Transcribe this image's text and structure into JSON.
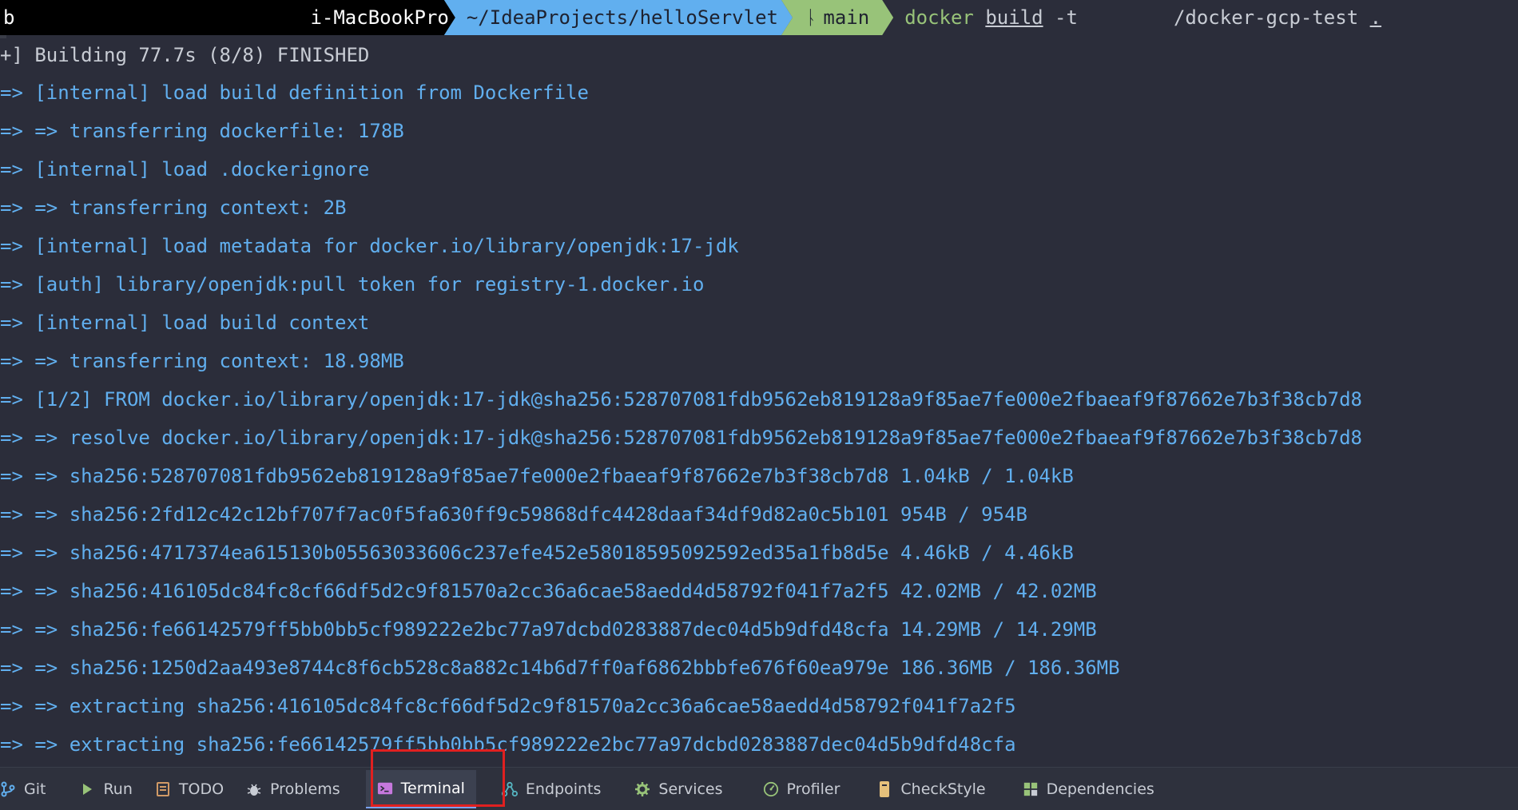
{
  "prompt": {
    "user_host": "i-MacBookPro",
    "leading_char": "b",
    "path": "~/IdeaProjects/helloServlet",
    "branch_icon": "git-branch-icon",
    "branch": "main",
    "command": "docker",
    "args": [
      "build",
      "-t",
      "/docker-gcp-test",
      "."
    ]
  },
  "output_lines": [
    "+] Building 77.7s (8/8) FINISHED",
    "=> [internal] load build definition from Dockerfile",
    "=> => transferring dockerfile: 178B",
    "=> [internal] load .dockerignore",
    "=> => transferring context: 2B",
    "=> [internal] load metadata for docker.io/library/openjdk:17-jdk",
    "=> [auth] library/openjdk:pull token for registry-1.docker.io",
    "=> [internal] load build context",
    "=> => transferring context: 18.98MB",
    "=> [1/2] FROM docker.io/library/openjdk:17-jdk@sha256:528707081fdb9562eb819128a9f85ae7fe000e2fbaeaf9f87662e7b3f38cb7d8",
    "=> => resolve docker.io/library/openjdk:17-jdk@sha256:528707081fdb9562eb819128a9f85ae7fe000e2fbaeaf9f87662e7b3f38cb7d8",
    "=> => sha256:528707081fdb9562eb819128a9f85ae7fe000e2fbaeaf9f87662e7b3f38cb7d8 1.04kB / 1.04kB",
    "=> => sha256:2fd12c42c12bf707f7ac0f5fa630ff9c59868dfc4428daaf34df9d82a0c5b101 954B / 954B",
    "=> => sha256:4717374ea615130b05563033606c237efe452e58018595092592ed35a1fb8d5e 4.46kB / 4.46kB",
    "=> => sha256:416105dc84fc8cf66df5d2c9f81570a2cc36a6cae58aedd4d58792f041f7a2f5 42.02MB / 42.02MB",
    "=> => sha256:fe66142579ff5bb0bb5cf989222e2bc77a97dcbd0283887dec04d5b9dfd48cfa 14.29MB / 14.29MB",
    "=> => sha256:1250d2aa493e8744c8f6cb528c8a882c14b6d7ff0af6862bbbfe676f60ea979e 186.36MB / 186.36MB",
    "=> => extracting sha256:416105dc84fc8cf66df5d2c9f81570a2cc36a6cae58aedd4d58792f041f7a2f5",
    "=> => extracting sha256:fe66142579ff5bb0bb5cf989222e2bc77a97dcbd0283887dec04d5b9dfd48cfa"
  ],
  "toolbar": {
    "tabs": [
      {
        "label": "Git",
        "icon": "git-branch-icon",
        "color": "#61afef"
      },
      {
        "label": "Run",
        "icon": "play-icon",
        "color": "#98c379"
      },
      {
        "label": "TODO",
        "icon": "todo-list-icon",
        "color": "#d19a66"
      },
      {
        "label": "Problems",
        "icon": "bug-icon",
        "color": "#c8ccd4"
      },
      {
        "label": "Terminal",
        "icon": "terminal-icon",
        "color": "#c678dd",
        "active": true
      },
      {
        "label": "Endpoints",
        "icon": "endpoints-icon",
        "color": "#56b6c2"
      },
      {
        "label": "Services",
        "icon": "gear-icon",
        "color": "#98c379"
      },
      {
        "label": "Profiler",
        "icon": "gauge-icon",
        "color": "#98c379"
      },
      {
        "label": "CheckStyle",
        "icon": "checkstyle-icon",
        "color": "#e5c07b"
      },
      {
        "label": "Dependencies",
        "icon": "dependencies-icon",
        "color": "#98c379"
      }
    ]
  },
  "colors": {
    "background": "#2b2d3a",
    "output_text": "#61afef",
    "prompt_path_bg": "#61afef",
    "prompt_branch_bg": "#98c379",
    "highlight_border": "#e02020"
  }
}
